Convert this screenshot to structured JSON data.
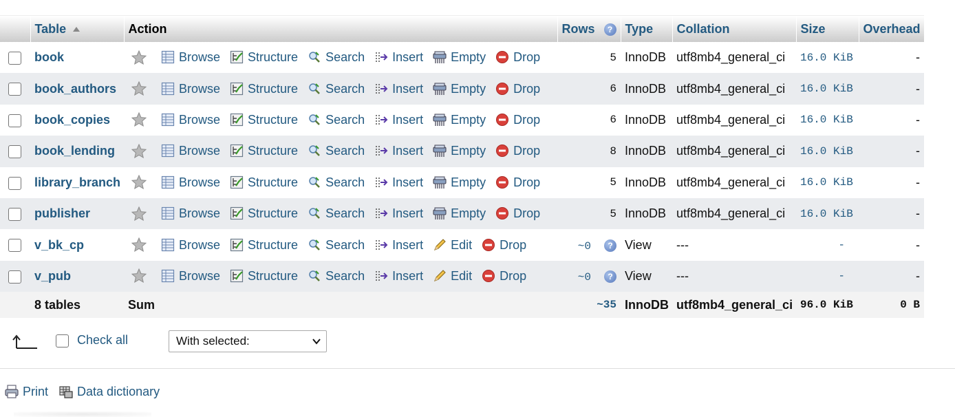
{
  "header": {
    "table": "Table",
    "action": "Action",
    "rows": "Rows",
    "type": "Type",
    "collation": "Collation",
    "size": "Size",
    "overhead": "Overhead"
  },
  "actions": {
    "browse": "Browse",
    "structure": "Structure",
    "search": "Search",
    "insert": "Insert",
    "empty": "Empty",
    "edit": "Edit",
    "drop": "Drop"
  },
  "tables": [
    {
      "name": "book",
      "rows": "5",
      "type": "InnoDB",
      "collation": "utf8mb4_general_ci",
      "size": "16.0 KiB",
      "overhead": "-",
      "is_view": false
    },
    {
      "name": "book_authors",
      "rows": "6",
      "type": "InnoDB",
      "collation": "utf8mb4_general_ci",
      "size": "16.0 KiB",
      "overhead": "-",
      "is_view": false
    },
    {
      "name": "book_copies",
      "rows": "6",
      "type": "InnoDB",
      "collation": "utf8mb4_general_ci",
      "size": "16.0 KiB",
      "overhead": "-",
      "is_view": false
    },
    {
      "name": "book_lending",
      "rows": "8",
      "type": "InnoDB",
      "collation": "utf8mb4_general_ci",
      "size": "16.0 KiB",
      "overhead": "-",
      "is_view": false
    },
    {
      "name": "library_branch",
      "rows": "5",
      "type": "InnoDB",
      "collation": "utf8mb4_general_ci",
      "size": "16.0 KiB",
      "overhead": "-",
      "is_view": false
    },
    {
      "name": "publisher",
      "rows": "5",
      "type": "InnoDB",
      "collation": "utf8mb4_general_ci",
      "size": "16.0 KiB",
      "overhead": "-",
      "is_view": false
    },
    {
      "name": "v_bk_cp",
      "rows": "~0",
      "type": "View",
      "collation": "---",
      "size": "-",
      "overhead": "-",
      "is_view": true
    },
    {
      "name": "v_pub",
      "rows": "~0",
      "type": "View",
      "collation": "---",
      "size": "-",
      "overhead": "-",
      "is_view": true
    }
  ],
  "footer_row": {
    "count": "8 tables",
    "sum": "Sum",
    "rows": "~35",
    "type": "InnoDB",
    "collation": "utf8mb4_general_ci",
    "size": "96.0 KiB",
    "overhead": "0 B"
  },
  "bulk": {
    "check_all": "Check all",
    "with_selected": "With selected:"
  },
  "links": {
    "print": "Print",
    "data_dictionary": "Data dictionary"
  },
  "colors": {
    "link": "#235a81",
    "row_alt": "#eaecef"
  }
}
